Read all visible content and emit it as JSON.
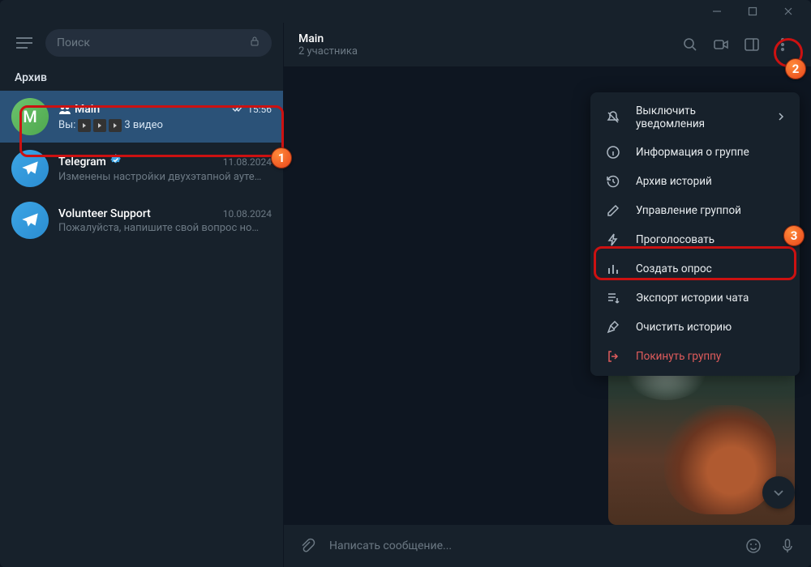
{
  "search": {
    "placeholder": "Поиск"
  },
  "archive_header": "Архив",
  "chats": [
    {
      "name": "Main",
      "time": "15:56",
      "preview_prefix": "Вы:",
      "preview_text": "3 видео",
      "selected": true
    },
    {
      "name": "Telegram",
      "time": "11.08.2024",
      "preview": "Изменены настройки двухэтапной ауте…",
      "verified": true
    },
    {
      "name": "Volunteer Support",
      "time": "10.08.2024",
      "preview": "Пожалуйста, напишите свой вопрос но…"
    }
  ],
  "header": {
    "title": "Main",
    "subtitle": "2 участника"
  },
  "menu": {
    "mute": "Выключить уведомления",
    "info": "Информация о группе",
    "stories": "Архив историй",
    "manage": "Управление группой",
    "boost": "Проголосовать",
    "poll": "Создать опрос",
    "export": "Экспорт истории чата",
    "clear": "Очистить историю",
    "leave": "Покинуть группу"
  },
  "composer": {
    "placeholder": "Написать сообщение..."
  },
  "badges": {
    "b1": "1",
    "b2": "2",
    "b3": "3"
  }
}
